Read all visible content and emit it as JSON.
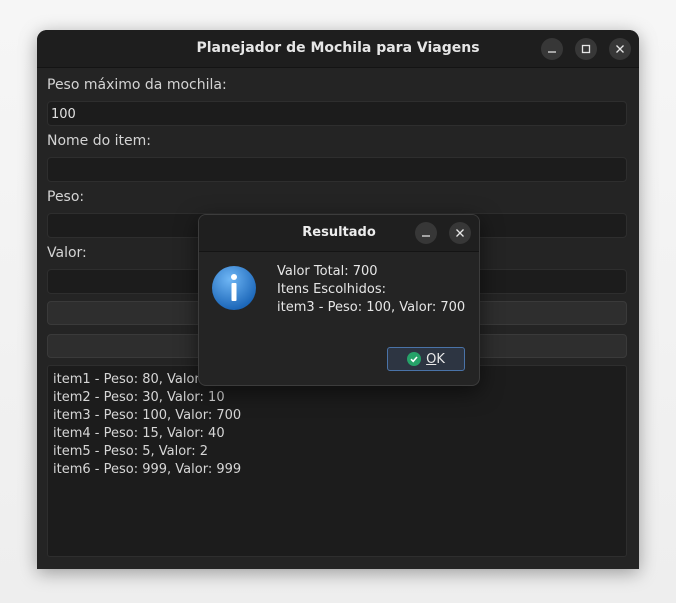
{
  "window": {
    "title": "Planejador de Mochila para Viagens",
    "minimize_icon": "minimize-icon",
    "maximize_icon": "maximize-icon",
    "close_icon": "close-icon"
  },
  "form": {
    "max_weight_label": "Peso máximo da mochila:",
    "max_weight_value": "100",
    "item_name_label": "Nome do item:",
    "item_name_value": "",
    "weight_label": "Peso:",
    "weight_value": "",
    "value_label": "Valor:",
    "value_value": ""
  },
  "items": [
    "item1 - Peso: 80, Valor: 100",
    "item2 - Peso: 30, Valor: 10",
    "item3 - Peso: 100, Valor: 700",
    "item4 - Peso: 15, Valor: 40",
    "item5 - Peso: 5, Valor: 2",
    "item6 - Peso: 999, Valor: 999"
  ],
  "dialog": {
    "title": "Resultado",
    "icon": "info-icon",
    "lines": [
      "Valor Total: 700",
      "Itens Escolhidos:",
      "item3 - Peso: 100, Valor: 700"
    ],
    "ok_label": "OK",
    "ok_mnemonic": "O",
    "ok_rest": "K"
  },
  "colors": {
    "window_bg": "#242424",
    "accent_blue": "#4a73a8",
    "check_green": "#26a269",
    "info_blue": "#2a7fd4"
  }
}
